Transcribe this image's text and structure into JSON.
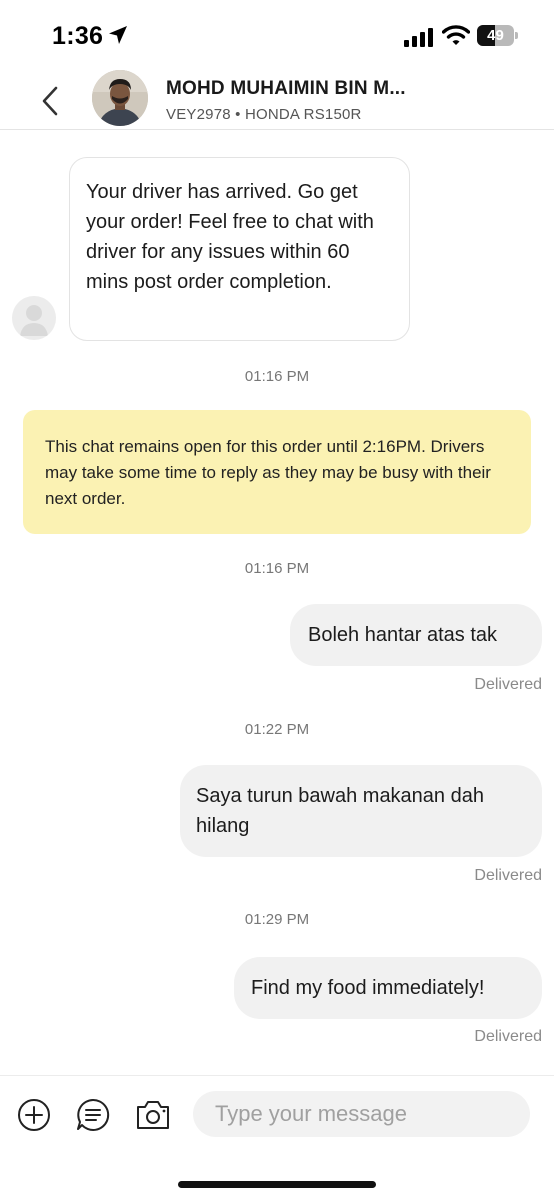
{
  "status_bar": {
    "time": "1:36",
    "battery_level": "49",
    "battery_fraction": 0.49,
    "icons": [
      "location-arrow-icon",
      "cellular-signal-icon",
      "wifi-icon",
      "battery-icon"
    ]
  },
  "header": {
    "driver_name": "MOHD MUHAIMIN BIN M...",
    "vehicle_info": "VEY2978 • HONDA RS150R",
    "icons": [
      "back-chevron-icon",
      "driver-avatar"
    ]
  },
  "messages": {
    "system_message": "Your driver has arrived. Go get your order! Feel free to chat with driver for any issues within 60 mins post order completion.",
    "system_time": "01:16 PM",
    "notice": "This chat remains open for this order until 2:16PM. Drivers may take some time to reply as they may be busy with their next order.",
    "outgoing": [
      {
        "time": "01:16 PM",
        "text": "Boleh hantar atas tak",
        "status": "Delivered"
      },
      {
        "time": "01:22 PM",
        "text": "Saya turun bawah makanan dah hilang",
        "status": "Delivered"
      },
      {
        "time": "01:29 PM",
        "text": "Find my food immediately!",
        "status": "Delivered"
      }
    ]
  },
  "input_bar": {
    "placeholder": "Type your message",
    "icons": [
      "add-icon",
      "quick-reply-icon",
      "camera-icon"
    ]
  },
  "colors": {
    "notice_background": "#fbf2b3",
    "outgoing_bubble": "#f1f1f1",
    "incoming_bubble_border": "#e3e3e3"
  }
}
